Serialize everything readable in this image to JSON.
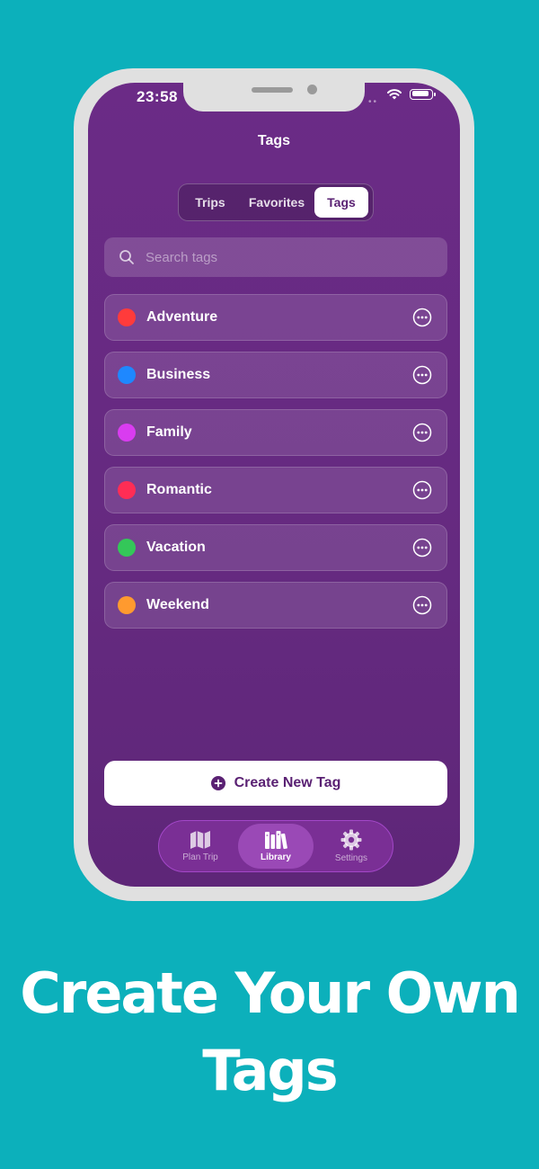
{
  "status": {
    "time": "23:58"
  },
  "nav": {
    "title": "Tags"
  },
  "segments": {
    "trips": "Trips",
    "favorites": "Favorites",
    "tags": "Tags",
    "selected": "Tags"
  },
  "search": {
    "placeholder": "Search tags",
    "value": ""
  },
  "tags": [
    {
      "name": "Adventure",
      "color": "#ff3b3b"
    },
    {
      "name": "Business",
      "color": "#1e88ff"
    },
    {
      "name": "Family",
      "color": "#d93cf0"
    },
    {
      "name": "Romantic",
      "color": "#ff2d55"
    },
    {
      "name": "Vacation",
      "color": "#34c759"
    },
    {
      "name": "Weekend",
      "color": "#ff9a2f"
    }
  ],
  "create_button": {
    "label": "Create New Tag"
  },
  "tab_bar": {
    "items": [
      {
        "label": "Plan Trip",
        "icon": "map-icon",
        "active": false
      },
      {
        "label": "Library",
        "icon": "books-icon",
        "active": true
      },
      {
        "label": "Settings",
        "icon": "gear-icon",
        "active": false
      }
    ]
  },
  "headline": {
    "line1": "Create Your Own",
    "line2": "Tags"
  },
  "colors": {
    "background": "#0cb0bb",
    "screen": "#67297f",
    "accent": "#5a2173"
  }
}
